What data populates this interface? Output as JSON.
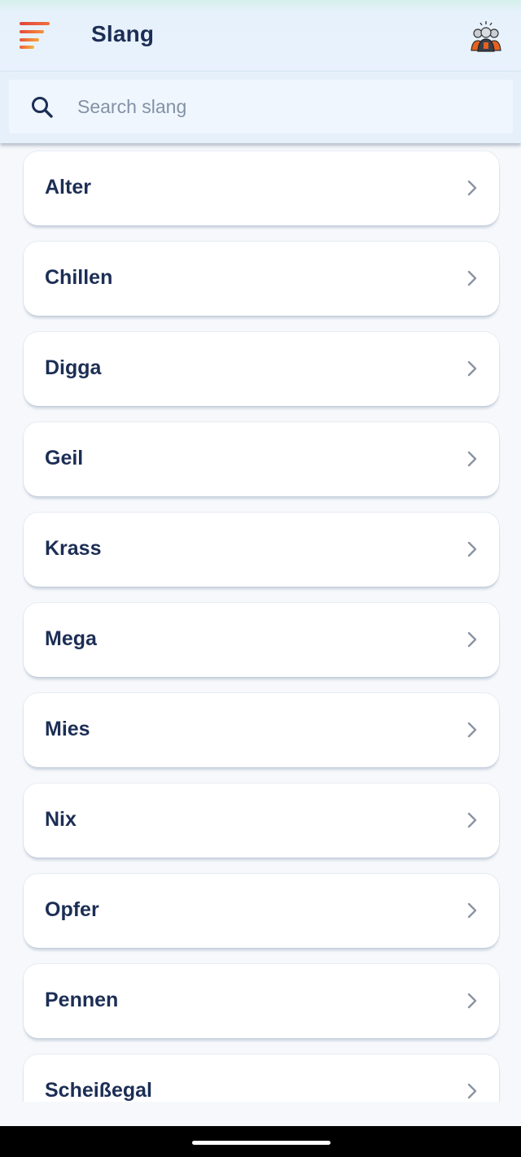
{
  "header": {
    "title": "Slang",
    "menu_icon": "menu-icon",
    "avatar_icon": "user-avatar-icon"
  },
  "search": {
    "placeholder": "Search slang",
    "value": ""
  },
  "slang_list": [
    {
      "label": "Alter"
    },
    {
      "label": "Chillen"
    },
    {
      "label": "Digga"
    },
    {
      "label": "Geil"
    },
    {
      "label": "Krass"
    },
    {
      "label": "Mega"
    },
    {
      "label": "Mies"
    },
    {
      "label": "Nix"
    },
    {
      "label": "Opfer"
    },
    {
      "label": "Pennen"
    },
    {
      "label": "Scheißegal"
    }
  ],
  "colors": {
    "text": "#1c2e55",
    "header_bg": "#e9f2fc",
    "menu_accent": "#e0443e"
  }
}
